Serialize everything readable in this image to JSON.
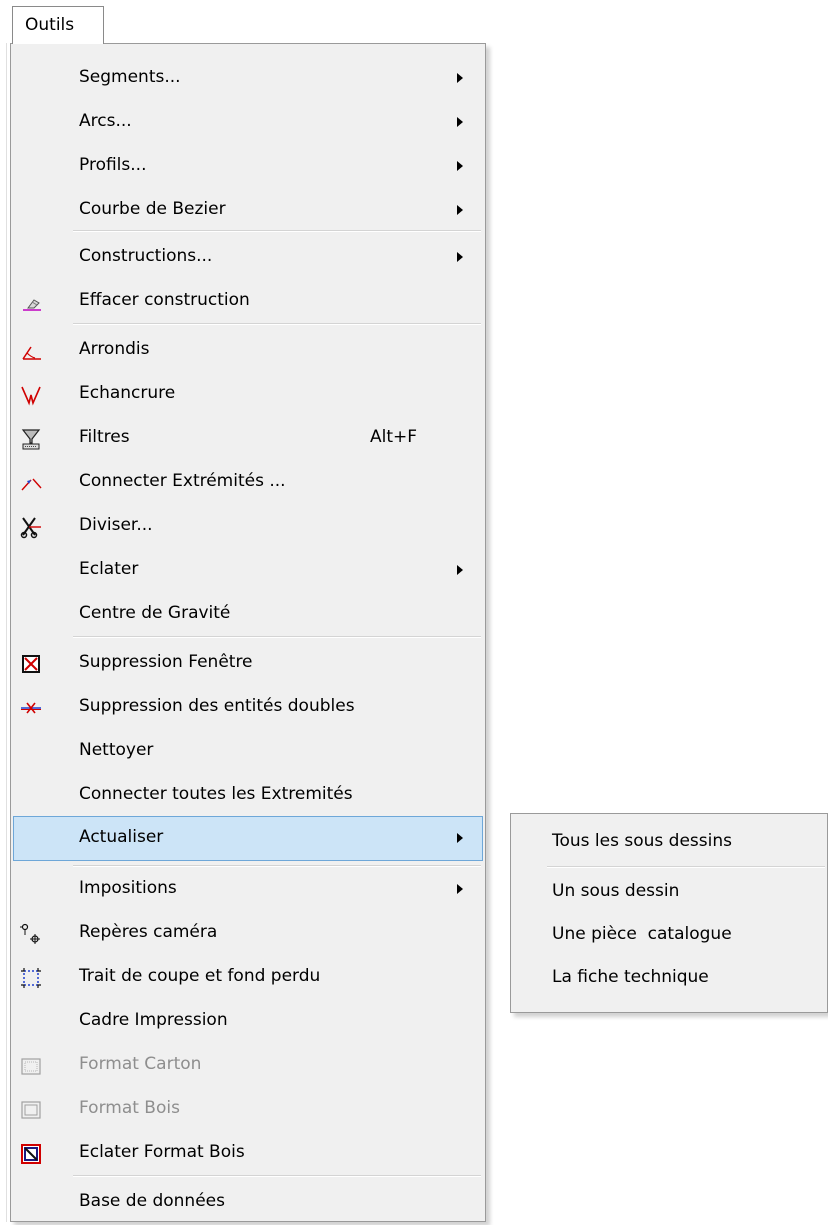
{
  "menubar": {
    "title": "Outils"
  },
  "menu": {
    "items": [
      {
        "label": "Segments...",
        "arrow": true
      },
      {
        "label": "Arcs...",
        "arrow": true
      },
      {
        "label": "Profils...",
        "arrow": true
      },
      {
        "label": "Courbe de Bezier",
        "arrow": true
      },
      {
        "label": "Constructions...",
        "arrow": true
      },
      {
        "label": "Effacer construction",
        "icon": "eraser-icon"
      },
      {
        "label": "Arrondis",
        "icon": "fillet-icon"
      },
      {
        "label": "Echancrure",
        "icon": "notch-icon"
      },
      {
        "label": "Filtres",
        "shortcut": "Alt+F",
        "icon": "filter-icon"
      },
      {
        "label": "Connecter Extrémités ...",
        "icon": "connect-ends-icon"
      },
      {
        "label": "Diviser...",
        "icon": "scissors-icon"
      },
      {
        "label": "Eclater",
        "arrow": true
      },
      {
        "label": "Centre de Gravité"
      },
      {
        "label": "Suppression Fenêtre",
        "icon": "delete-window-icon"
      },
      {
        "label": "Suppression des entités doubles",
        "icon": "delete-duplicates-icon"
      },
      {
        "label": "Nettoyer"
      },
      {
        "label": "Connecter toutes les Extremités"
      },
      {
        "label": "Actualiser",
        "arrow": true,
        "highlighted": true
      },
      {
        "label": "Impositions",
        "arrow": true
      },
      {
        "label": "Repères caméra",
        "icon": "camera-marks-icon"
      },
      {
        "label": "Trait de coupe et fond perdu",
        "icon": "crop-bleed-icon"
      },
      {
        "label": "Cadre Impression"
      },
      {
        "label": "Format Carton",
        "icon": "cardboard-format-icon",
        "disabled": true
      },
      {
        "label": "Format Bois",
        "icon": "wood-format-icon",
        "disabled": true
      },
      {
        "label": "Eclater Format Bois",
        "icon": "explode-wood-format-icon"
      },
      {
        "label": "Base de données"
      }
    ]
  },
  "submenu": {
    "items": [
      {
        "label": "Tous les sous dessins"
      },
      {
        "label": "Un sous dessin"
      },
      {
        "label": "Une pièce  catalogue"
      },
      {
        "label": "La fiche technique"
      }
    ]
  },
  "colors": {
    "highlight_bg": "#cce4f7",
    "highlight_border": "#6ea7d8",
    "disabled_text": "#8e8e8e",
    "menu_bg": "#f0f0f0"
  }
}
